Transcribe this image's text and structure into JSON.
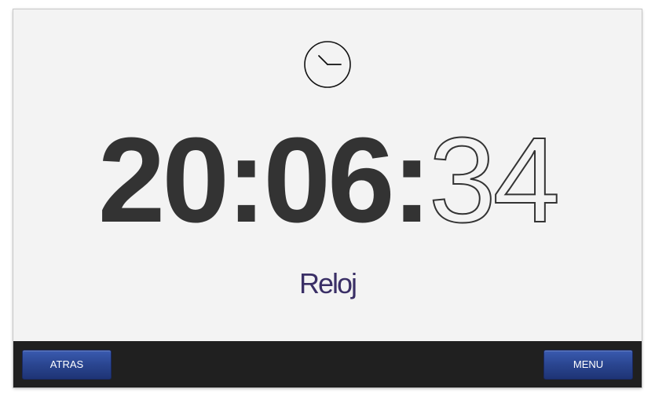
{
  "clock": {
    "icon": "clock-icon",
    "hours": "20",
    "sep1": ":",
    "minutes": "06",
    "sep2": ":",
    "seconds": "34"
  },
  "title": "Reloj",
  "footer": {
    "back_label": "ATRAS",
    "menu_label": "MENU"
  },
  "colors": {
    "background": "#f3f3f3",
    "text": "#333333",
    "bar": "#202020",
    "button": "#2a4590"
  }
}
